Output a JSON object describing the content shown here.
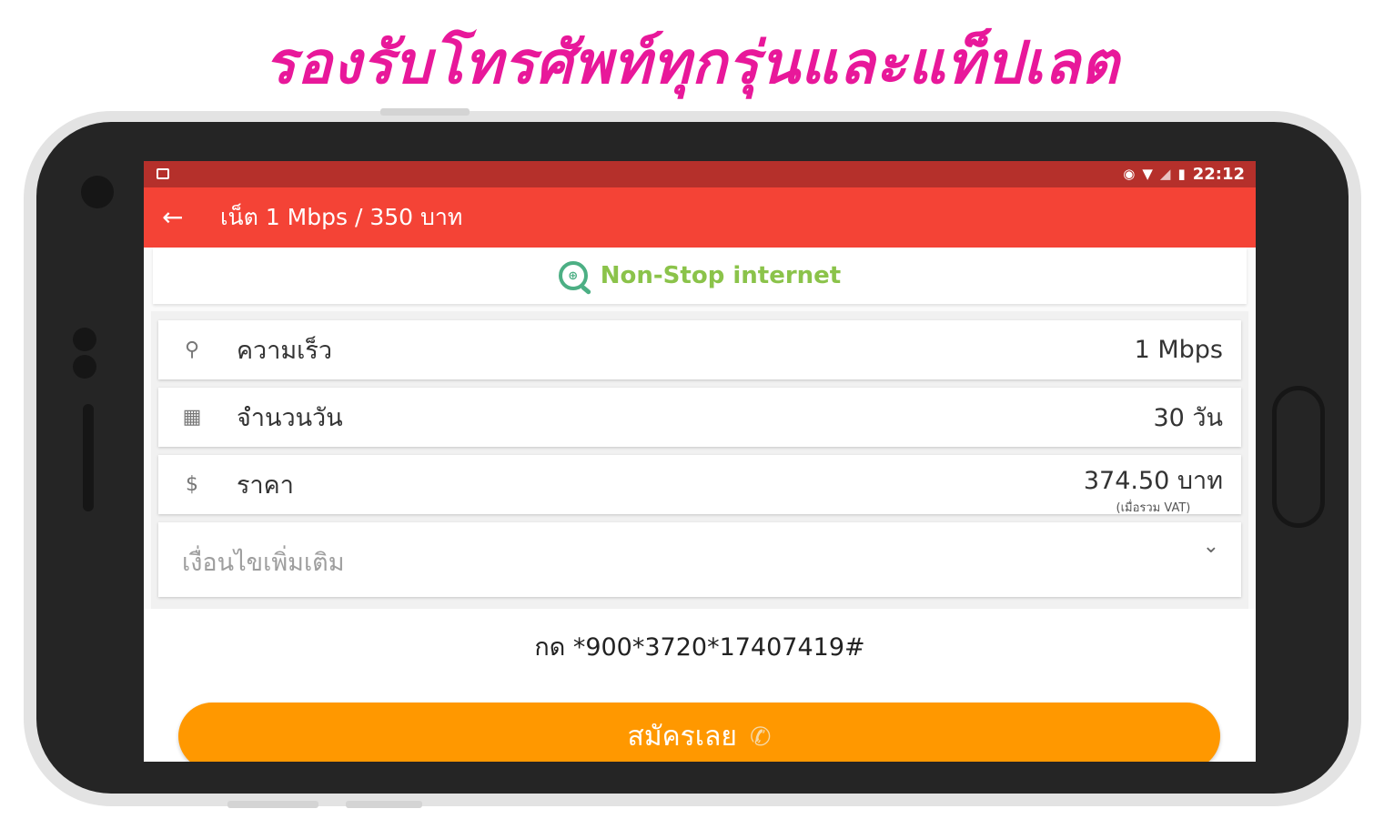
{
  "banner": {
    "text": "รองรับโทรศัพท์ทุกรุ่นและแท็ปเลต",
    "color": "#e8189a"
  },
  "status_bar": {
    "time": "22:12",
    "icons": [
      "notification-icon",
      "data-saver-icon",
      "wifi-icon",
      "signal-icon",
      "battery-icon"
    ],
    "color": "#b5302b"
  },
  "app_bar": {
    "back_icon": "arrow-left-icon",
    "title": "เน็ต 1 Mbps / 350 บาท",
    "color": "#f44336"
  },
  "brand": {
    "logo_icon": "search-globe-icon",
    "name": "Non-Stop internet",
    "color": "#8bc34a"
  },
  "details": {
    "speed": {
      "icon": "bicycle-icon",
      "label": "ความเร็ว",
      "value": "1 Mbps"
    },
    "days": {
      "icon": "calendar-icon",
      "label": "จำนวนวัน",
      "value": "30 วัน"
    },
    "price": {
      "icon": "dollar-icon",
      "label": "ราคา",
      "value": "374.50 บาท",
      "note": "(เมื่อรวม VAT)"
    },
    "conditions": {
      "label": "เงื่อนไขเพิ่มเติม",
      "icon": "chevron-down-icon"
    }
  },
  "ussd": {
    "text": "กด *900*3720*17407419#"
  },
  "subscribe": {
    "label": "สมัครเลย",
    "icon": "phone-icon",
    "color": "#ff9800"
  }
}
